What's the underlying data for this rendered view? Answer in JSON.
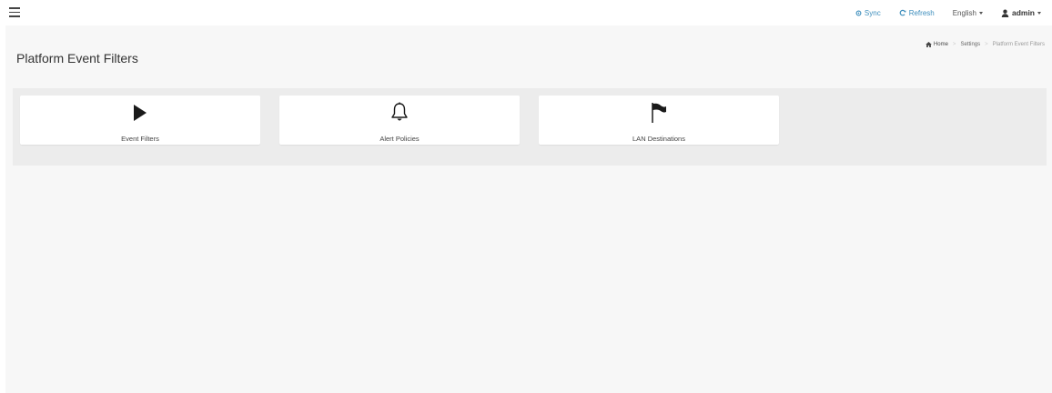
{
  "topbar": {
    "sync_label": "Sync",
    "refresh_label": "Refresh",
    "language_label": "English",
    "user_label": "admin"
  },
  "page": {
    "title": "Platform Event Filters"
  },
  "breadcrumb": {
    "home": "Home",
    "settings": "Settings",
    "current": "Platform Event Filters"
  },
  "cards": [
    {
      "label": "Event Filters",
      "icon": "play-icon"
    },
    {
      "label": "Alert Policies",
      "icon": "bell-icon"
    },
    {
      "label": "LAN Destinations",
      "icon": "flag-icon"
    }
  ],
  "colors": {
    "link": "#3c8dbc",
    "content_bg": "#f7f7f7",
    "panel_bg": "#ececec"
  }
}
